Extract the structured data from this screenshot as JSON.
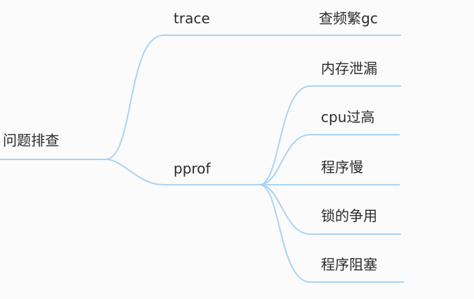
{
  "mindmap": {
    "root": {
      "label": "问题排查"
    },
    "branches": [
      {
        "label": "trace",
        "children": [
          {
            "label": "查频繁gc"
          }
        ]
      },
      {
        "label": "pprof",
        "children": [
          {
            "label": "内存泄漏"
          },
          {
            "label": "cpu过高"
          },
          {
            "label": "程序慢"
          },
          {
            "label": "锁的争用"
          },
          {
            "label": "程序阻塞"
          }
        ]
      }
    ]
  },
  "colors": {
    "edge": "#a9d3f5",
    "text": "#2b2b2b",
    "background": "#fbfbfb"
  }
}
